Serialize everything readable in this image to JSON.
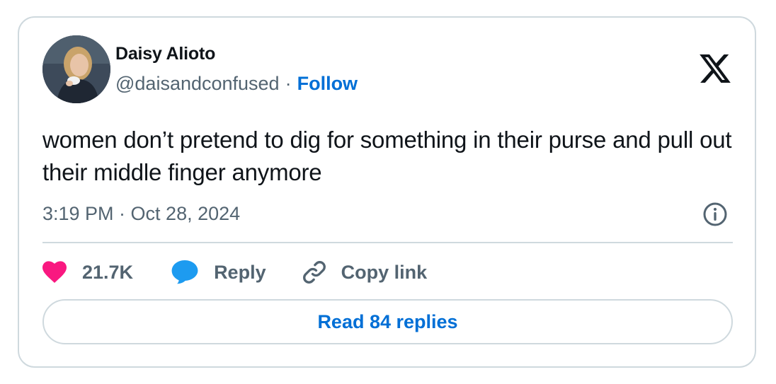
{
  "author": {
    "name": "Daisy Alioto",
    "handle": "@daisandconfused",
    "separator": "·",
    "follow_label": "Follow"
  },
  "tweet": {
    "text": "women don’t pretend to dig for something in their purse and pull out their middle finger anymore",
    "timestamp": "3:19 PM · Oct 28, 2024"
  },
  "actions": {
    "like_count": "21.7K",
    "reply_label": "Reply",
    "copy_label": "Copy link"
  },
  "read_replies_label": "Read 84 replies",
  "icons": {
    "brand": "x-logo-icon",
    "info": "info-icon",
    "like": "heart-icon",
    "reply": "speech-bubble-icon",
    "copy": "link-icon"
  },
  "colors": {
    "like": "#f91880",
    "reply": "#1d9bf0",
    "link": "#006fd6",
    "muted": "#536471",
    "border": "#cfd9de"
  }
}
